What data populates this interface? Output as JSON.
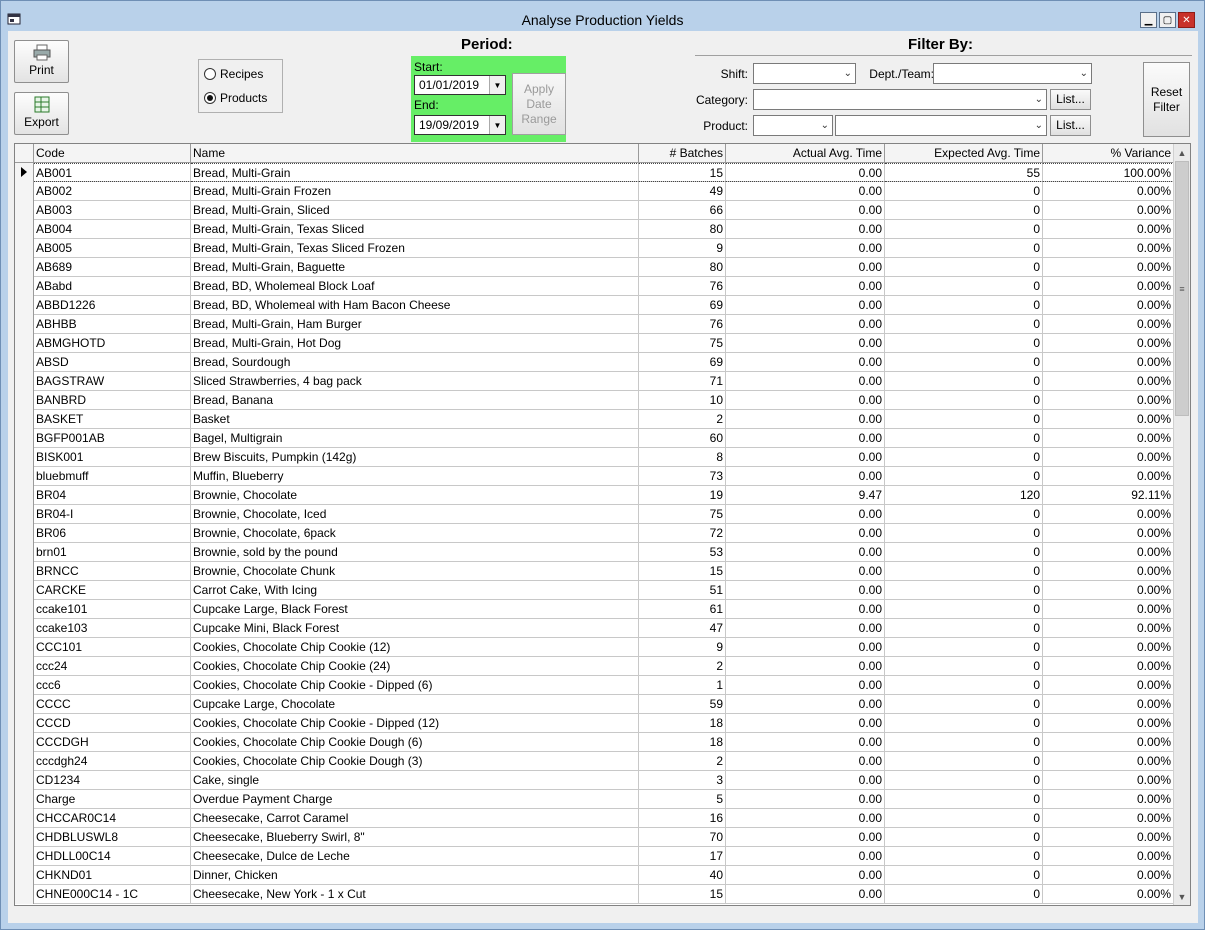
{
  "window": {
    "title": "Analyse Production Yields",
    "min_glyph": "▁",
    "max_glyph": "▢",
    "close_glyph": "✕"
  },
  "toolbar": {
    "print_label": "Print",
    "export_label": "Export"
  },
  "mode": {
    "recipes_label": "Recipes",
    "products_label": "Products",
    "selected": "Products"
  },
  "period": {
    "title": "Period:",
    "start_label": "Start:",
    "start_value": "01/01/2019",
    "end_label": "End:",
    "end_value": "19/09/2019",
    "apply_label": "Apply Date Range",
    "highlight_color": "#66ee66"
  },
  "filter": {
    "title": "Filter By:",
    "shift_label": "Shift:",
    "dept_label": "Dept./Team:",
    "category_label": "Category:",
    "product_label": "Product:",
    "list_label": "List...",
    "reset_label": "Reset Filter"
  },
  "grid": {
    "columns": [
      "Code",
      "Name",
      "# Batches",
      "Actual Avg. Time",
      "Expected Avg. Time",
      "% Variance"
    ],
    "selected_row": 0,
    "rows": [
      [
        "AB001",
        "Bread, Multi-Grain",
        "15",
        "0.00",
        "55",
        "100.00%"
      ],
      [
        "AB002",
        "Bread, Multi-Grain Frozen",
        "49",
        "0.00",
        "0",
        "0.00%"
      ],
      [
        "AB003",
        "Bread, Multi-Grain, Sliced",
        "66",
        "0.00",
        "0",
        "0.00%"
      ],
      [
        "AB004",
        "Bread, Multi-Grain, Texas Sliced",
        "80",
        "0.00",
        "0",
        "0.00%"
      ],
      [
        "AB005",
        "Bread, Multi-Grain, Texas Sliced Frozen",
        "9",
        "0.00",
        "0",
        "0.00%"
      ],
      [
        "AB689",
        "Bread, Multi-Grain, Baguette",
        "80",
        "0.00",
        "0",
        "0.00%"
      ],
      [
        "ABabd",
        "Bread, BD, Wholemeal Block Loaf",
        "76",
        "0.00",
        "0",
        "0.00%"
      ],
      [
        "ABBD1226",
        "Bread, BD, Wholemeal with Ham Bacon Cheese",
        "69",
        "0.00",
        "0",
        "0.00%"
      ],
      [
        "ABHBB",
        "Bread, Multi-Grain, Ham Burger",
        "76",
        "0.00",
        "0",
        "0.00%"
      ],
      [
        "ABMGHOTD",
        "Bread, Multi-Grain, Hot Dog",
        "75",
        "0.00",
        "0",
        "0.00%"
      ],
      [
        "ABSD",
        "Bread, Sourdough",
        "69",
        "0.00",
        "0",
        "0.00%"
      ],
      [
        "BAGSTRAW",
        "Sliced Strawberries, 4 bag pack",
        "71",
        "0.00",
        "0",
        "0.00%"
      ],
      [
        "BANBRD",
        "Bread, Banana",
        "10",
        "0.00",
        "0",
        "0.00%"
      ],
      [
        "BASKET",
        "Basket",
        "2",
        "0.00",
        "0",
        "0.00%"
      ],
      [
        "BGFP001AB",
        "Bagel, Multigrain",
        "60",
        "0.00",
        "0",
        "0.00%"
      ],
      [
        "BISK001",
        "Brew Biscuits, Pumpkin (142g)",
        "8",
        "0.00",
        "0",
        "0.00%"
      ],
      [
        "bluebmuff",
        "Muffin, Blueberry",
        "73",
        "0.00",
        "0",
        "0.00%"
      ],
      [
        "BR04",
        "Brownie, Chocolate",
        "19",
        "9.47",
        "120",
        "92.11%"
      ],
      [
        "BR04-I",
        "Brownie, Chocolate, Iced",
        "75",
        "0.00",
        "0",
        "0.00%"
      ],
      [
        "BR06",
        "Brownie, Chocolate, 6pack",
        "72",
        "0.00",
        "0",
        "0.00%"
      ],
      [
        "brn01",
        "Brownie, sold by the pound",
        "53",
        "0.00",
        "0",
        "0.00%"
      ],
      [
        "BRNCC",
        "Brownie, Chocolate Chunk",
        "15",
        "0.00",
        "0",
        "0.00%"
      ],
      [
        "CARCKE",
        "Carrot Cake, With Icing",
        "51",
        "0.00",
        "0",
        "0.00%"
      ],
      [
        "ccake101",
        "Cupcake Large, Black Forest",
        "61",
        "0.00",
        "0",
        "0.00%"
      ],
      [
        "ccake103",
        "Cupcake Mini, Black Forest",
        "47",
        "0.00",
        "0",
        "0.00%"
      ],
      [
        "CCC101",
        "Cookies, Chocolate Chip Cookie (12)",
        "9",
        "0.00",
        "0",
        "0.00%"
      ],
      [
        "ccc24",
        "Cookies, Chocolate Chip Cookie (24)",
        "2",
        "0.00",
        "0",
        "0.00%"
      ],
      [
        "ccc6",
        "Cookies, Chocolate Chip Cookie - Dipped (6)",
        "1",
        "0.00",
        "0",
        "0.00%"
      ],
      [
        "CCCC",
        "Cupcake Large, Chocolate",
        "59",
        "0.00",
        "0",
        "0.00%"
      ],
      [
        "CCCD",
        "Cookies, Chocolate Chip Cookie - Dipped (12)",
        "18",
        "0.00",
        "0",
        "0.00%"
      ],
      [
        "CCCDGH",
        "Cookies, Chocolate Chip Cookie Dough (6)",
        "18",
        "0.00",
        "0",
        "0.00%"
      ],
      [
        "cccdgh24",
        "Cookies, Chocolate Chip Cookie Dough (3)",
        "2",
        "0.00",
        "0",
        "0.00%"
      ],
      [
        "CD1234",
        "Cake, single",
        "3",
        "0.00",
        "0",
        "0.00%"
      ],
      [
        "Charge",
        "Overdue Payment Charge",
        "5",
        "0.00",
        "0",
        "0.00%"
      ],
      [
        "CHCCAR0C14",
        "Cheesecake, Carrot Caramel",
        "16",
        "0.00",
        "0",
        "0.00%"
      ],
      [
        "CHDBLUSWL8",
        "Cheesecake, Blueberry Swirl, 8\"",
        "70",
        "0.00",
        "0",
        "0.00%"
      ],
      [
        "CHDLL00C14",
        "Cheesecake, Dulce de Leche",
        "17",
        "0.00",
        "0",
        "0.00%"
      ],
      [
        "CHKND01",
        "Dinner, Chicken",
        "40",
        "0.00",
        "0",
        "0.00%"
      ],
      [
        "CHNE000C14 - 1C",
        "Cheesecake, New York - 1 x Cut",
        "15",
        "0.00",
        "0",
        "0.00%"
      ]
    ]
  }
}
